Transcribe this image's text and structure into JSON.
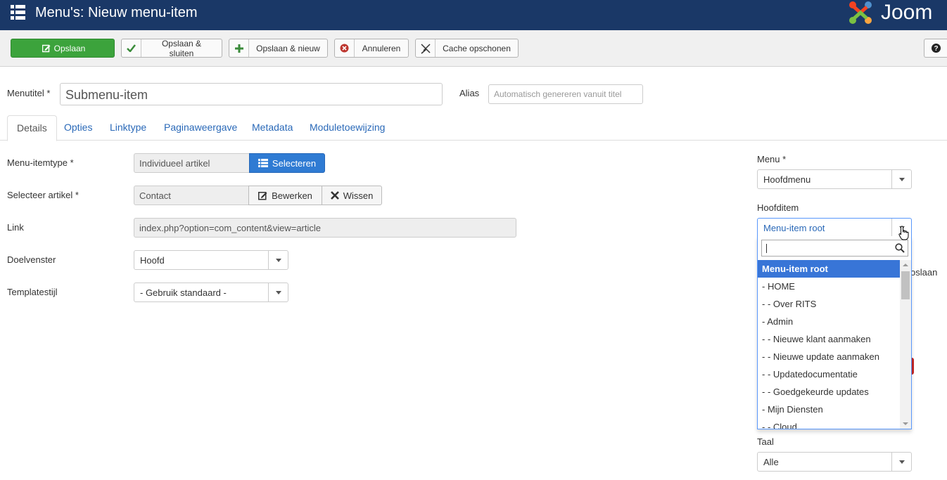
{
  "header": {
    "title": "Menu's: Nieuw menu-item",
    "logo_text": "Joom"
  },
  "toolbar": {
    "save": "Opslaan",
    "save_close": "Opslaan & sluiten",
    "save_new": "Opslaan & nieuw",
    "cancel": "Annuleren",
    "clear_cache": "Cache opschonen"
  },
  "form": {
    "title_label": "Menutitel *",
    "title_value": "Submenu-item",
    "alias_label": "Alias",
    "alias_placeholder": "Automatisch genereren vanuit titel"
  },
  "tabs": [
    "Details",
    "Opties",
    "Linktype",
    "Paginaweergave",
    "Metadata",
    "Moduletoewijzing"
  ],
  "details": {
    "type_label": "Menu-itemtype *",
    "type_value": "Individueel artikel",
    "select_btn": "Selecteren",
    "article_label": "Selecteer artikel *",
    "article_value": "Contact",
    "edit_btn": "Bewerken",
    "clear_btn": "Wissen",
    "link_label": "Link",
    "link_value": "index.php?option=com_content&view=article",
    "target_label": "Doelvenster",
    "target_value": "Hoofd",
    "template_label": "Templatestijl",
    "template_value": "- Gebruik standaard -"
  },
  "sidebar": {
    "menu_label": "Menu *",
    "menu_value": "Hoofdmenu",
    "parent_label": "Hoofditem",
    "parent_value": "Menu-item root",
    "lang_label": "Taal",
    "lang_value": "Alle",
    "partial_text": "oslaan"
  },
  "dropdown": {
    "items": [
      "Menu-item root",
      "- HOME",
      "- - Over RITS",
      "- Admin",
      "- - Nieuwe klant aanmaken",
      "- - Nieuwe update aanmaken",
      "- - Updatedocumentatie",
      "- - Goedgekeurde updates",
      "- Mijn Diensten",
      "- - Cloud"
    ]
  },
  "colors": {
    "header": "#1a3867",
    "save": "#3ca33c",
    "primary": "#2f7bd3",
    "link": "#2a69b8",
    "selected": "#3875d7"
  }
}
